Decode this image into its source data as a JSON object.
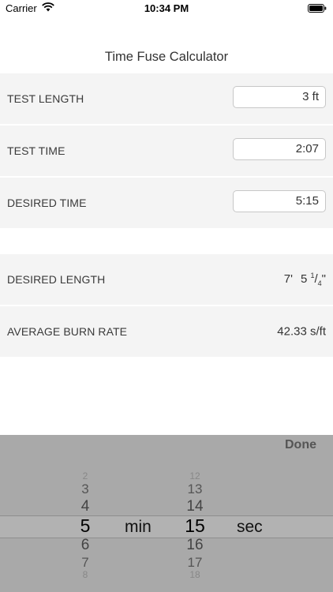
{
  "status_bar": {
    "carrier": "Carrier",
    "time": "10:34 PM",
    "wifi_icon": "wifi-icon",
    "battery_icon": "battery-icon"
  },
  "title": "Time Fuse Calculator",
  "inputs": {
    "test_length": {
      "label": "TEST LENGTH",
      "value": "3 ft"
    },
    "test_time": {
      "label": "TEST TIME",
      "value": "2:07"
    },
    "desired_time": {
      "label": "DESIRED TIME",
      "value": "5:15"
    }
  },
  "results": {
    "desired_length": {
      "label": "DESIRED LENGTH",
      "feet": "7'",
      "inches_whole": "5",
      "frac_num": "1",
      "frac_den": "4",
      "inch_mark": "\""
    },
    "average_burn_rate": {
      "label": "AVERAGE BURN RATE",
      "value": "42.33 s/ft"
    }
  },
  "picker": {
    "done_label": "Done",
    "minutes": [
      "2",
      "3",
      "4",
      "5",
      "6",
      "7",
      "8"
    ],
    "minutes_unit": "min",
    "seconds": [
      "12",
      "13",
      "14",
      "15",
      "16",
      "17",
      "18"
    ],
    "seconds_unit": "sec",
    "selected_minutes": "5",
    "selected_seconds": "15"
  },
  "colors": {
    "row_background": "#f4f4f4",
    "picker_background": "#a9a9a9"
  }
}
